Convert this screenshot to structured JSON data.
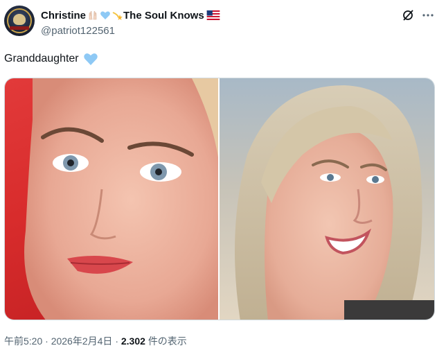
{
  "author": {
    "display_name": "Christine",
    "display_name_suffix": "The Soul Knows",
    "emojis": [
      "raised-hands-emoji",
      "blue-heart-emoji",
      "shooting-star-emoji",
      "us-flag-emoji"
    ],
    "handle": "@patriot122561"
  },
  "tweet": {
    "text": "Granddaughter",
    "text_emoji": "blue-heart-emoji"
  },
  "media": {
    "images": [
      "photo-left",
      "photo-right"
    ]
  },
  "footer": {
    "time": "午前5:20",
    "sep1": "·",
    "date": "2026年2月4日",
    "sep2": "·",
    "views": "2.302",
    "views_label": "件の表示"
  },
  "colors": {
    "text": "#0f1419",
    "muted": "#536471",
    "blue_heart": "#8ec9f5"
  }
}
